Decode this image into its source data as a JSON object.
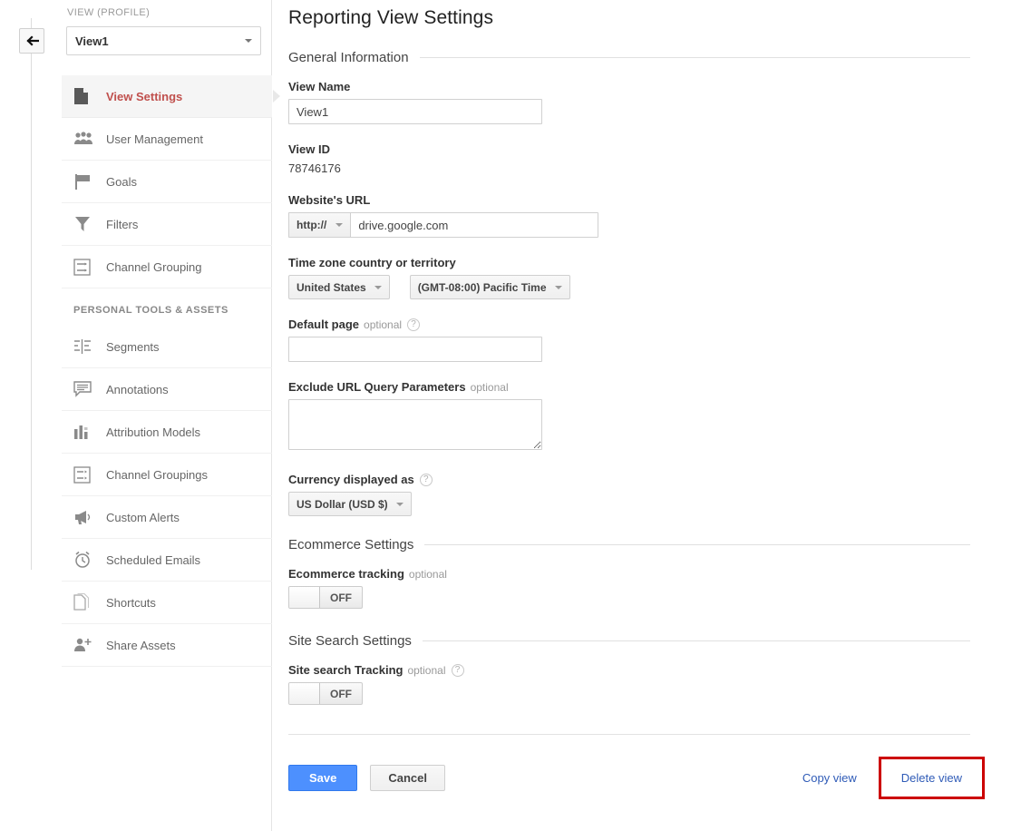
{
  "back_button": {
    "icon": "back-arrow-icon"
  },
  "sidebar": {
    "view_label": "VIEW (PROFILE)",
    "view_select": {
      "value": "View1",
      "caret": "chevron-down-icon"
    },
    "items": [
      {
        "label": "View Settings",
        "icon": "document-icon",
        "active": true
      },
      {
        "label": "User Management",
        "icon": "users-icon",
        "active": false
      },
      {
        "label": "Goals",
        "icon": "flag-icon",
        "active": false
      },
      {
        "label": "Filters",
        "icon": "funnel-icon",
        "active": false
      },
      {
        "label": "Channel Grouping",
        "icon": "channel-grouping-icon",
        "active": false
      }
    ],
    "group_title": "PERSONAL TOOLS & ASSETS",
    "tools": [
      {
        "label": "Segments",
        "icon": "segments-icon"
      },
      {
        "label": "Annotations",
        "icon": "annotation-icon"
      },
      {
        "label": "Attribution Models",
        "icon": "bar-chart-icon"
      },
      {
        "label": "Channel Groupings",
        "icon": "channel-grouping-icon"
      },
      {
        "label": "Custom Alerts",
        "icon": "megaphone-icon"
      },
      {
        "label": "Scheduled Emails",
        "icon": "alarm-clock-icon"
      },
      {
        "label": "Shortcuts",
        "icon": "copy-page-icon"
      },
      {
        "label": "Share Assets",
        "icon": "person-add-icon"
      }
    ]
  },
  "main": {
    "title": "Reporting View Settings",
    "sections": {
      "general": "General Information",
      "ecommerce": "Ecommerce Settings",
      "site_search": "Site Search Settings"
    },
    "view_name": {
      "label": "View Name",
      "value": "View1"
    },
    "view_id": {
      "label": "View ID",
      "value": "78746176"
    },
    "website_url": {
      "label": "Website's URL",
      "protocol": "http://",
      "value": "drive.google.com"
    },
    "time_zone": {
      "label": "Time zone country or territory",
      "country": "United States",
      "zone": "(GMT-08:00) Pacific Time"
    },
    "default_page": {
      "label": "Default page",
      "optional": "optional",
      "help": "?",
      "value": ""
    },
    "exclude_params": {
      "label": "Exclude URL Query Parameters",
      "optional": "optional",
      "value": ""
    },
    "currency": {
      "label": "Currency displayed as",
      "help": "?",
      "value": "US Dollar (USD $)"
    },
    "ecommerce_tracking": {
      "label": "Ecommerce tracking",
      "optional": "optional",
      "state": "OFF"
    },
    "site_search_tracking": {
      "label": "Site search Tracking",
      "optional": "optional",
      "help": "?",
      "state": "OFF"
    }
  },
  "footer": {
    "save": "Save",
    "cancel": "Cancel",
    "copy_view": "Copy view",
    "delete_view": "Delete view"
  },
  "colors": {
    "accent_red": "#c0504d",
    "primary_blue": "#4d90fe",
    "link_blue": "#2f5bb7",
    "highlight_red": "#cc0000"
  }
}
